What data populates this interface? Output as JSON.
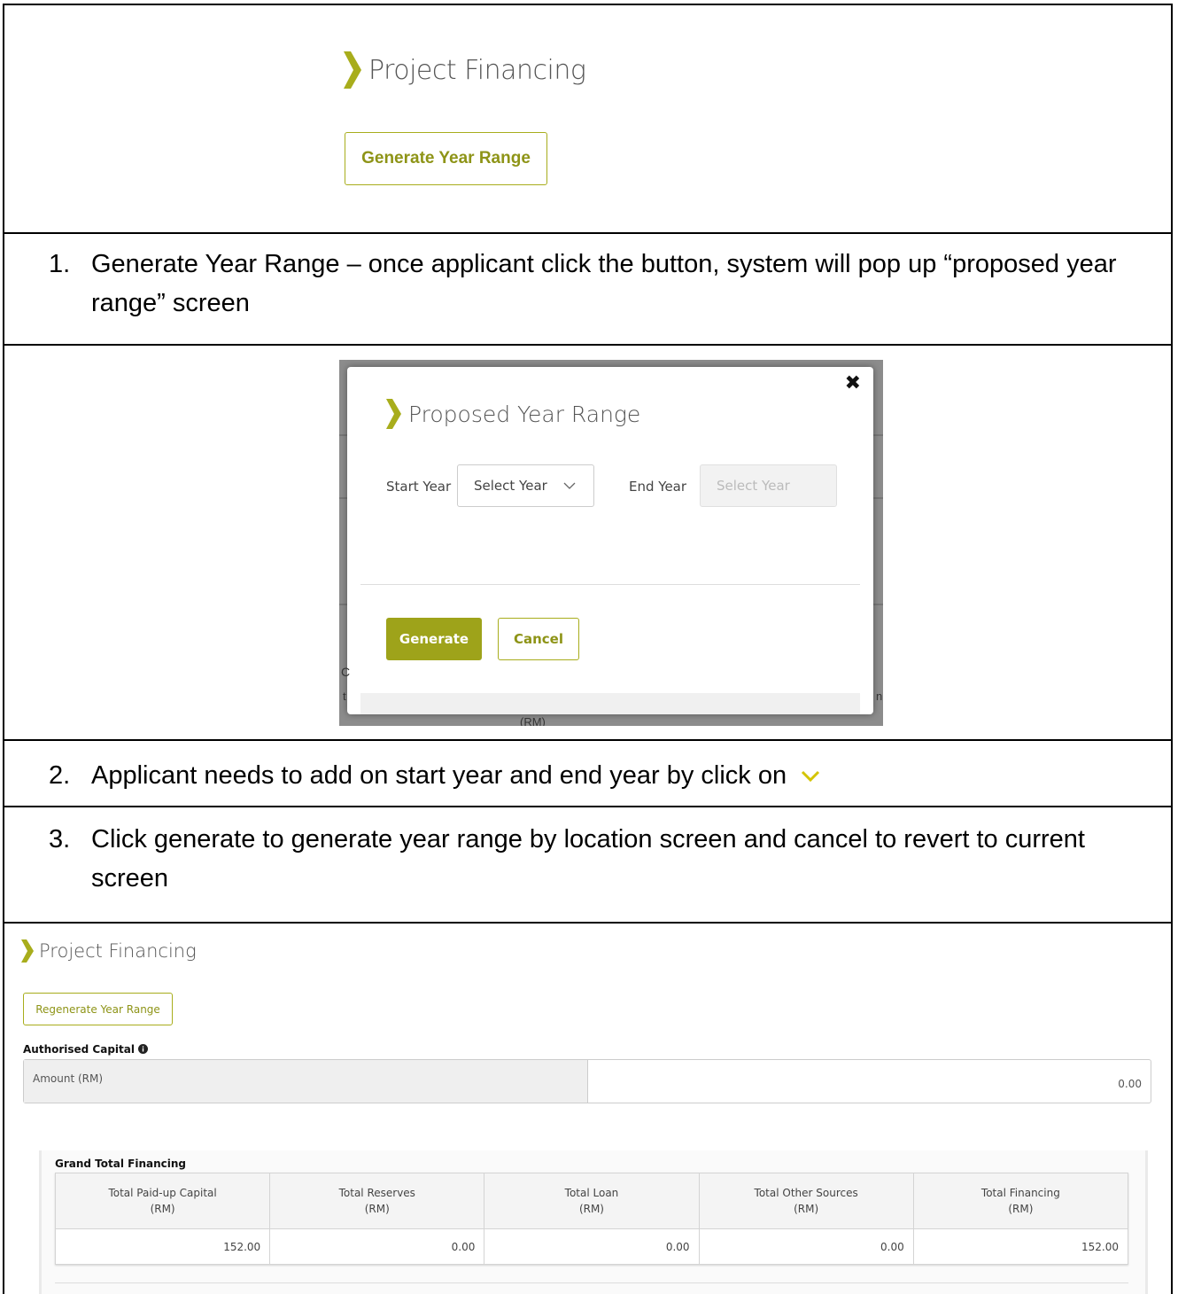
{
  "section1": {
    "title": "Project Financing",
    "generate_button": "Generate Year Range"
  },
  "step1": {
    "number": "1.",
    "text": "Generate Year Range – once applicant click the button, system will pop up “proposed year range” screen"
  },
  "modal": {
    "close": "✖",
    "title": "Proposed Year Range",
    "start_year_label": "Start Year",
    "start_year_placeholder": "Select Year",
    "end_year_label": "End Year",
    "end_year_placeholder": "Select Year",
    "generate_button": "Generate",
    "cancel_button": "Cancel",
    "background_fragments": [
      "C",
      "t",
      "n",
      "(RM)"
    ]
  },
  "step2": {
    "number": "2.",
    "text": "Applicant needs to add on start year and end year by click on"
  },
  "step3": {
    "number": "3.",
    "text": "Click generate to generate year range by location screen and cancel to revert to current screen"
  },
  "bottom": {
    "title": "Project Financing",
    "regenerate_button": "Regenerate Year Range",
    "authorised_capital_label": "Authorised Capital",
    "amount_label": "Amount (RM)",
    "amount_value": "0.00",
    "grand_total_label": "Grand Total Financing",
    "columns": [
      {
        "name": "Total Paid-up Capital",
        "unit": "(RM)"
      },
      {
        "name": "Total Reserves",
        "unit": "(RM)"
      },
      {
        "name": "Total Loan",
        "unit": "(RM)"
      },
      {
        "name": "Total Other Sources",
        "unit": "(RM)"
      },
      {
        "name": "Total Financing",
        "unit": "(RM)"
      }
    ],
    "values": [
      "152.00",
      "0.00",
      "0.00",
      "0.00",
      "152.00"
    ]
  },
  "colors": {
    "accent": "#a8ad1c",
    "accent_text": "#8e9417",
    "accent_solid": "#9ea31a"
  }
}
